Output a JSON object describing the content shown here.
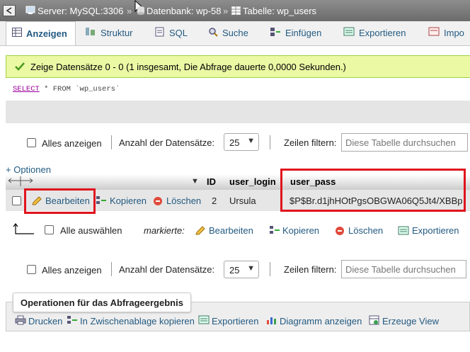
{
  "breadcrumb": {
    "server": "Server: MySQL:3306",
    "database": "Datenbank: wp-58",
    "table": "Tabelle: wp_users",
    "separator": "»"
  },
  "tabs": [
    {
      "label": "Anzeigen",
      "icon": "browse-icon",
      "active": true
    },
    {
      "label": "Struktur",
      "icon": "structure-icon",
      "active": false
    },
    {
      "label": "SQL",
      "icon": "sql-icon",
      "active": false
    },
    {
      "label": "Suche",
      "icon": "search-icon",
      "active": false
    },
    {
      "label": "Einfügen",
      "icon": "insert-icon",
      "active": false
    },
    {
      "label": "Exportieren",
      "icon": "export-icon",
      "active": false
    },
    {
      "label": "Impo",
      "icon": "import-icon",
      "active": false
    }
  ],
  "message": {
    "text": "Zeige Datensätze 0 - 0 (1 insgesamt, Die Abfrage dauerte 0,0000 Sekunden.)",
    "icon": "check-icon"
  },
  "query": {
    "keyword": "SELECT",
    "rest": " * FROM `wp_users`"
  },
  "nav_top": {
    "show_all": "Alles anzeigen",
    "rows_label": "Anzahl der Datensätze:",
    "rows_value": "25",
    "filter_label": "Zeilen filtern:",
    "filter_placeholder": "Diese Tabelle durchsuchen"
  },
  "options_link": "+ Optionen",
  "table": {
    "headers": {
      "id": "ID",
      "login": "user_login",
      "pass": "user_pass"
    },
    "row": {
      "edit": "Bearbeiten",
      "copy": "Kopieren",
      "delete": "Löschen",
      "id": "2",
      "login": "Ursula",
      "pass": "$P$Br.d1jhHOtPgsOBGWA06Q5Jt4/XBBp"
    }
  },
  "bulk": {
    "select_all": "Alle auswählen",
    "marked": "markierte:",
    "edit": "Bearbeiten",
    "copy": "Kopieren",
    "delete": "Löschen",
    "export": "Exportieren"
  },
  "nav_bottom": {
    "show_all": "Alles anzeigen",
    "rows_label": "Anzahl der Datensätze:",
    "rows_value": "25",
    "filter_label": "Zeilen filtern:",
    "filter_placeholder": "Diese Tabelle durchsuchen"
  },
  "operations": {
    "title": "Operationen für das Abfrageergebnis",
    "items": [
      "Drucken",
      "In Zwischenablage kopieren",
      "Exportieren",
      "Diagramm anzeigen",
      "Erzeuge View"
    ]
  },
  "colors": {
    "highlight": "#e0141e",
    "link": "#235a81",
    "success_bg": "#ebf8a4"
  }
}
